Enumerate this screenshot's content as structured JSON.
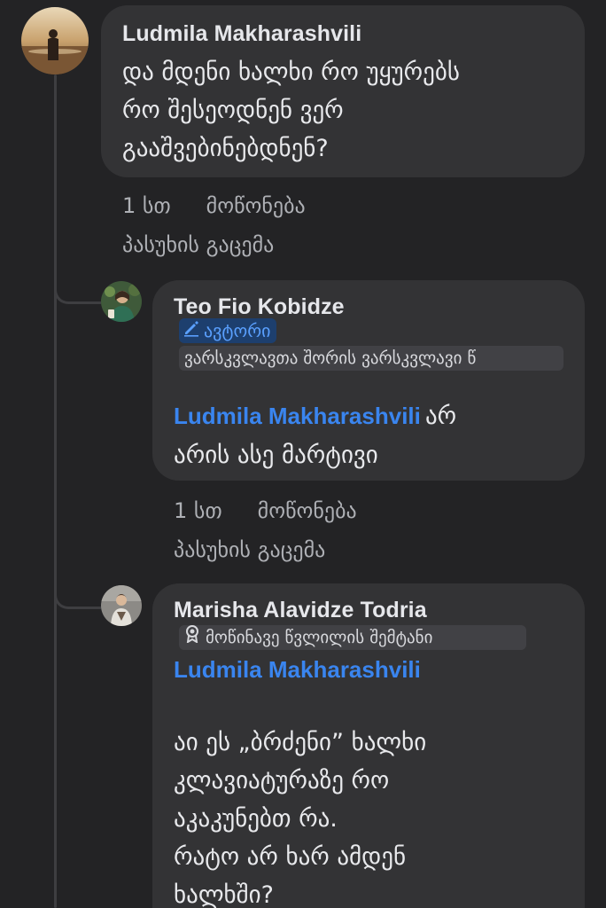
{
  "comments": [
    {
      "author": "Ludmila Makharashvili",
      "lines": [
        "და მდენი ხალხი რო უყურებს",
        "რო შესეოდნენ ვერ",
        "გააშვებინებდნენ?"
      ],
      "time": "1 სთ",
      "like": "მოწონება",
      "reply": "პასუხის გაცემა"
    },
    {
      "author": "Teo Fio Kobidze",
      "badge_author": "ავტორი",
      "badge_title": "ვარსკვლავთა შორის ვარსკვლავი წ",
      "mention": "Ludmila Makharashvili",
      "mention_tail": "არ",
      "line2": "არის ასე მარტივი",
      "time": "1 სთ",
      "like": "მოწონება",
      "reply": "პასუხის გაცემა"
    },
    {
      "author": "Marisha Alavidze Todria",
      "badge_title": "მოწინავე წვლილის შემტანი",
      "mention": "Ludmila Makharashvili",
      "lines": [
        "აი ეს „ბრძენი” ხალხი",
        "კლავიატურაზე რო",
        "აკაკუნებთ რა.",
        "რატო არ ხარ ამდენ",
        "ხალხში?"
      ]
    }
  ],
  "icons": {
    "author_badge": "pencil-icon",
    "contributor_badge": "award-icon"
  },
  "colors": {
    "background": "#232325",
    "bubble": "#333335",
    "mention": "#3a85ef",
    "author_badge_bg": "#1d3f6e"
  }
}
